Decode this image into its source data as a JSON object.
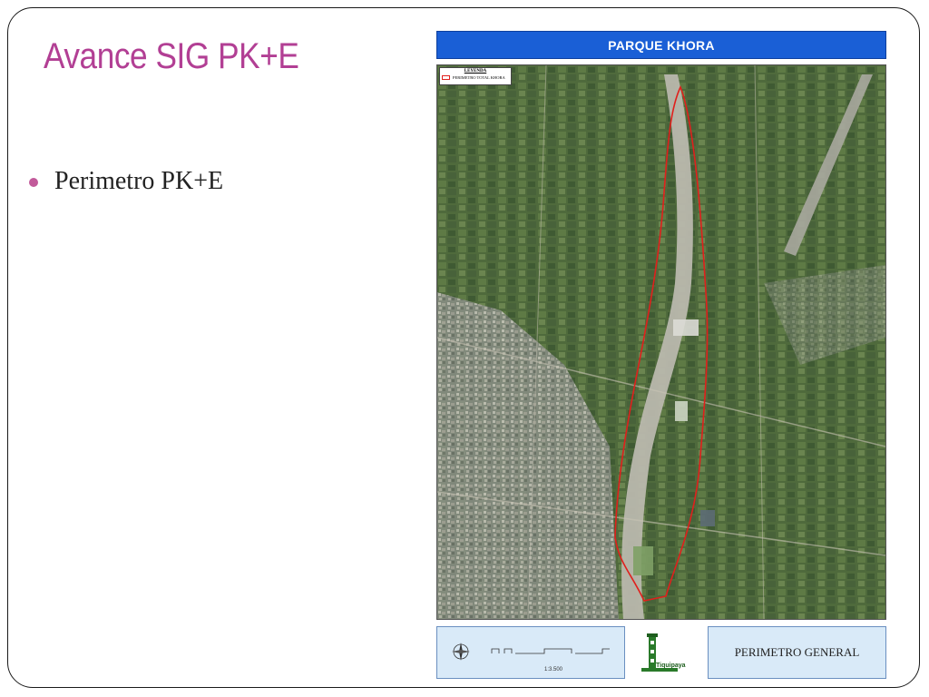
{
  "slide": {
    "title": "Avance SIG PK+E",
    "bullets": [
      "Perimetro PK+E"
    ]
  },
  "map": {
    "banner_title": "PARQUE KHORA",
    "legend": {
      "title": "LEYENDA",
      "entry": "PERIMETRO TOTAL KHORA"
    },
    "footer": {
      "scale_label": "1:3.500",
      "logo_text": "Tiquipaya",
      "panel_title": "PERIMETRO GENERAL"
    },
    "icons": [
      "north-arrow-icon",
      "scale-bar-icon",
      "municipal-tower-logo-icon"
    ],
    "colors": {
      "banner": "#1a5fd6",
      "perimeter": "#e0201c",
      "title": "#b23f94",
      "footer_panel": "#d9eaf8"
    }
  }
}
